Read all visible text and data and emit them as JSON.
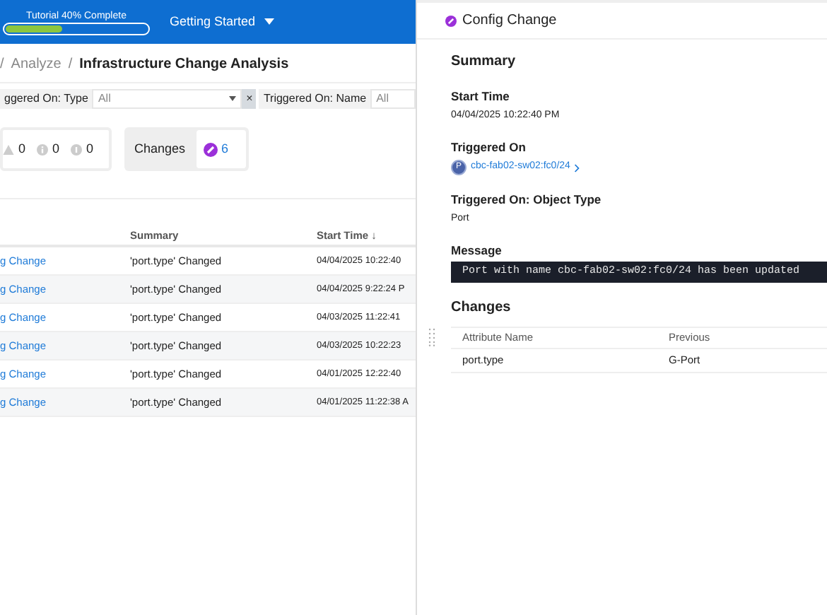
{
  "topbar": {
    "tutorial": {
      "label": "Tutorial 40% Complete",
      "level": 0.4
    },
    "menu": "Getting Started"
  },
  "breadcrumb": {
    "items": [
      "/",
      "Analyze",
      "/"
    ],
    "current": "Infrastructure Change Analysis"
  },
  "filters": [
    {
      "label": "ggered On: Type",
      "value": "All",
      "dropdown": true,
      "clear": "×"
    },
    {
      "label": "Triggered On: Name",
      "value": "All",
      "dropdown": false
    }
  ],
  "counts": [
    {
      "kind": "warning",
      "value": "0"
    },
    {
      "kind": "info",
      "value": "0"
    },
    {
      "kind": "note",
      "value": "0"
    }
  ],
  "changes_card": {
    "label": "Changes",
    "count": "6"
  },
  "table": {
    "columns": [
      "Summary",
      "Start Time ↓"
    ],
    "rows": [
      {
        "name": "g Change",
        "summary": "'port.type' Changed",
        "start": "04/04/2025 10:22:40"
      },
      {
        "name": "g Change",
        "summary": "'port.type' Changed",
        "start": "04/04/2025 9:22:24 P"
      },
      {
        "name": "g Change",
        "summary": "'port.type' Changed",
        "start": "04/03/2025 11:22:41"
      },
      {
        "name": "g Change",
        "summary": "'port.type' Changed",
        "start": "04/03/2025 10:22:23"
      },
      {
        "name": "g Change",
        "summary": "'port.type' Changed",
        "start": "04/01/2025 12:22:40"
      },
      {
        "name": "g Change",
        "summary": "'port.type' Changed",
        "start": "04/01/2025 11:22:38 A"
      }
    ]
  },
  "detail": {
    "title": "Config Change",
    "section": "Summary",
    "fields": [
      {
        "kind": "text",
        "label": "Start Time",
        "value": "04/04/2025 10:22:40 PM"
      },
      {
        "kind": "link",
        "label": "Triggered On",
        "badge": "P",
        "value": "cbc-fab02-sw02:fc0/24"
      },
      {
        "kind": "text",
        "label": "Triggered On: Object Type",
        "value": "Port"
      },
      {
        "kind": "code",
        "label": "Message",
        "value": "Port with name cbc-fab02-sw02:fc0/24 has been updated"
      }
    ],
    "changes": {
      "title": "Changes",
      "columns": [
        "Attribute Name",
        "Previous"
      ],
      "rows": [
        [
          "port.type",
          "G-Port"
        ]
      ]
    }
  }
}
